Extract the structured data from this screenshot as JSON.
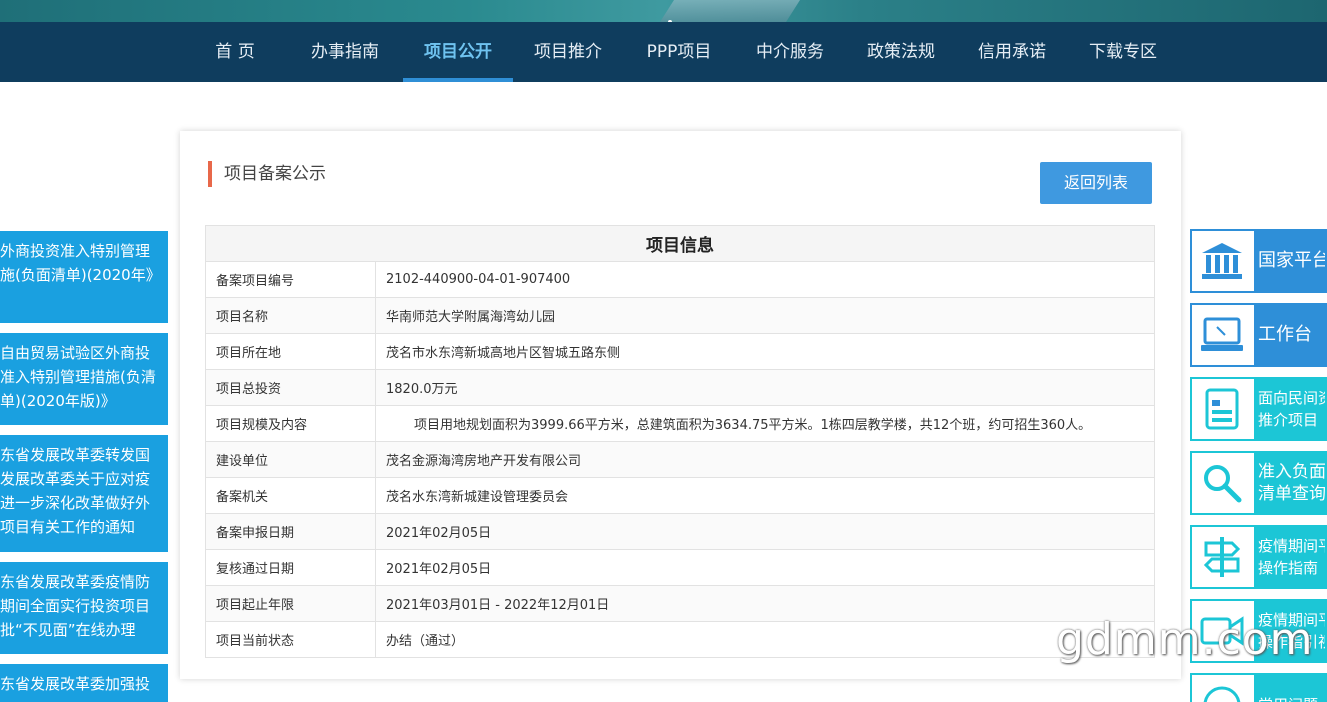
{
  "nav": {
    "items": [
      "首 页",
      "办事指南",
      "项目公开",
      "项目推介",
      "PPP项目",
      "中介服务",
      "政策法规",
      "信用承诺",
      "下载专区"
    ],
    "active_index": 2
  },
  "card": {
    "title": "项目备案公示",
    "back_button": "返回列表",
    "table_header": "项目信息",
    "rows": [
      {
        "label": "备案项目编号",
        "value": "2102-440900-04-01-907400"
      },
      {
        "label": "项目名称",
        "value": "华南师范大学附属海湾幼儿园"
      },
      {
        "label": "项目所在地",
        "value": "茂名市水东湾新城高地片区智城五路东侧"
      },
      {
        "label": "项目总投资",
        "value": "1820.0万元"
      },
      {
        "label": "项目规模及内容",
        "value": "项目用地规划面积为3999.66平方米，总建筑面积为3634.75平方米。1栋四层教学楼，共12个班，约可招生360人。"
      },
      {
        "label": "建设单位",
        "value": "茂名金源海湾房地产开发有限公司"
      },
      {
        "label": "备案机关",
        "value": "茂名水东湾新城建设管理委员会"
      },
      {
        "label": "备案申报日期",
        "value": "2021年02月05日"
      },
      {
        "label": "复核通过日期",
        "value": "2021年02月05日"
      },
      {
        "label": "项目起止年限",
        "value": "2021年03月01日 - 2022年12月01日"
      },
      {
        "label": "项目当前状态",
        "value": "办结（通过）"
      }
    ]
  },
  "left_links": [
    "外商投资准入特别管理施(负面清单)(2020年》",
    "自由贸易试验区外商投准入特别管理措施(负清单)(2020年版)》",
    "东省发展改革委转发国发展改革委关于应对疫进一步深化改革做好外项目有关工作的通知",
    "东省发展改革委疫情防期间全面实行投资项目批“不见面”在线办理",
    "东省发展改革委加强投"
  ],
  "right_links": [
    {
      "label": "国家平台",
      "icon": "government-building-icon",
      "style": "blue"
    },
    {
      "label": "工作台",
      "icon": "computer-monitor-icon",
      "style": "blue"
    },
    {
      "label": "面向民间资\n推介项目",
      "icon": "document-list-icon",
      "style": "cyan"
    },
    {
      "label": "准入负面\n清单查询",
      "icon": "search-icon",
      "style": "cyan"
    },
    {
      "label": "疫情期间平\n操作指南",
      "icon": "signpost-icon",
      "style": "cyan"
    },
    {
      "label": "疫情期间平\n操作指引视",
      "icon": "video-camera-icon",
      "style": "cyan"
    },
    {
      "label": "常用问题",
      "icon": "help-icon",
      "style": "cyan"
    }
  ],
  "watermark": "gdmm.com",
  "colors": {
    "nav_bg": "#0f3d5e",
    "active": "#2f8fd6",
    "left_bg": "#1aa0e0",
    "right_cyan": "#1cc6d6",
    "right_blue": "#2e8fd8",
    "title_accent": "#e8684a"
  }
}
